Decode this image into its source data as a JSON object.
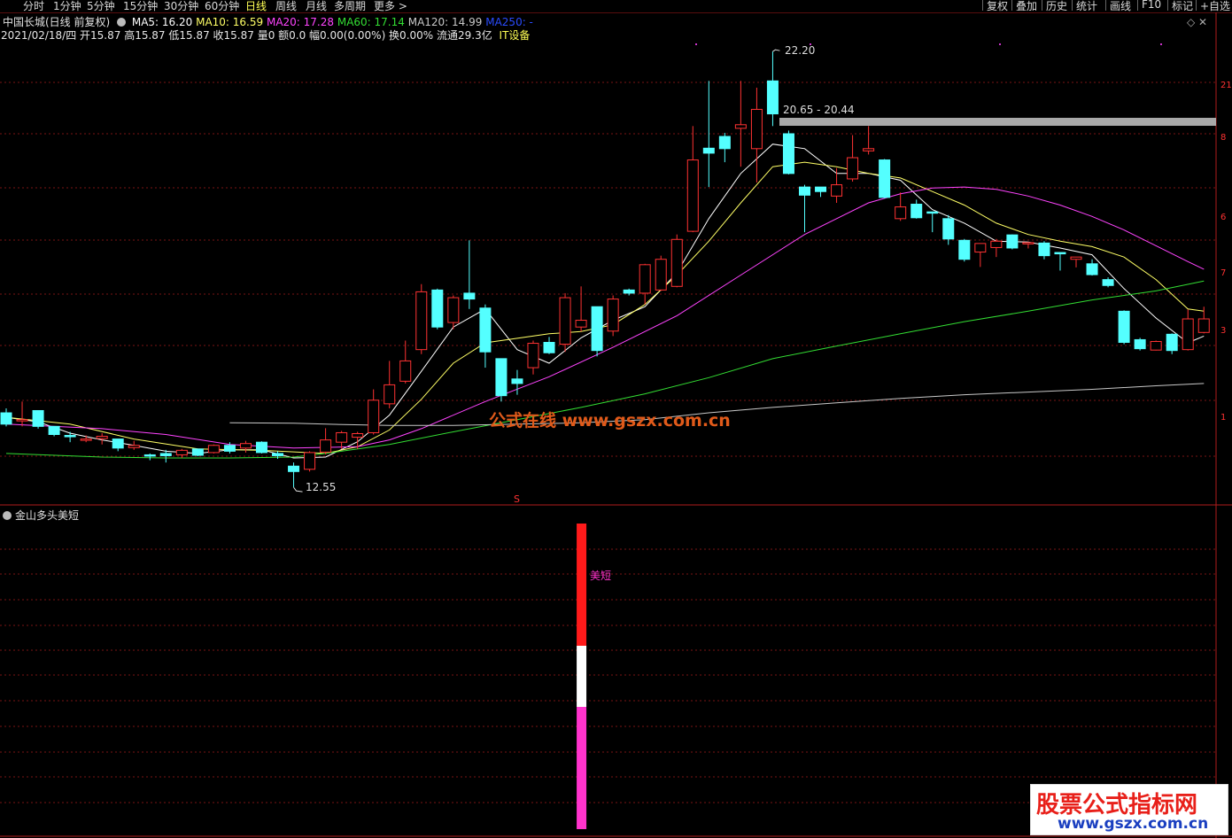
{
  "toolbar": {
    "periods": [
      "分时",
      "1分钟",
      "5分钟",
      "15分钟",
      "30分钟",
      "60分钟",
      "日线",
      "周线",
      "月线",
      "多周期",
      "更多 >"
    ],
    "active_period": "日线",
    "right_buttons": [
      "复权",
      "叠加",
      "历史",
      "统计",
      "画线",
      "F10",
      "标记",
      "+自选"
    ]
  },
  "info": {
    "stock": "中国长城(日线 前复权)",
    "ma5": "MA5: 16.20",
    "ma10": "MA10: 16.59",
    "ma20": "MA20: 17.28",
    "ma60": "MA60: 17.14",
    "ma120": "MA120: 14.99",
    "ma250": "MA250: -",
    "bar_line": "2021/02/18/四 开15.87 高15.87 低15.87 收15.87 量0 额0.0 幅0.00(0.00%) 换0.00% 流通29.3亿",
    "sector": "IT设备"
  },
  "colors": {
    "up": "#ff3232",
    "down": "#54ffff",
    "ma5": "#ffffff",
    "ma10": "#ffff66",
    "ma20": "#ff44ff",
    "ma60": "#33dd33",
    "ma120": "#c8c8c8",
    "ma250": "#2a4cff",
    "grid": "#7a1414"
  },
  "annotations": {
    "high": "22.20",
    "low": "12.55",
    "zone": "20.65 - 20.44",
    "signal_marker": "S"
  },
  "right_axis_fragments": [
    "21",
    "8",
    "6",
    "7",
    "3",
    "1"
  ],
  "sub_panel": {
    "title": "金山多头美短",
    "signal_label": "美短"
  },
  "watermarks": {
    "center": "公式在线  www.gszx.com.cn",
    "corner_title": "股票公式指标网",
    "corner_url": "www.gszx.com.cn"
  },
  "chart_data": {
    "type": "candlestick",
    "price_axis_range": [
      12.2,
      22.4
    ],
    "candles": [
      {
        "o": 14.2,
        "h": 14.3,
        "l": 13.9,
        "c": 13.95
      },
      {
        "o": 14.05,
        "h": 14.45,
        "l": 13.9,
        "c": 14.05
      },
      {
        "o": 14.25,
        "h": 14.25,
        "l": 13.85,
        "c": 13.9
      },
      {
        "o": 13.9,
        "h": 13.9,
        "l": 13.68,
        "c": 13.72
      },
      {
        "o": 13.7,
        "h": 13.78,
        "l": 13.55,
        "c": 13.68
      },
      {
        "o": 13.6,
        "h": 13.7,
        "l": 13.55,
        "c": 13.62
      },
      {
        "o": 13.63,
        "h": 13.75,
        "l": 13.5,
        "c": 13.68
      },
      {
        "o": 13.62,
        "h": 13.62,
        "l": 13.35,
        "c": 13.42
      },
      {
        "o": 13.43,
        "h": 13.58,
        "l": 13.38,
        "c": 13.48
      },
      {
        "o": 13.27,
        "h": 13.3,
        "l": 13.15,
        "c": 13.26
      },
      {
        "o": 13.3,
        "h": 13.38,
        "l": 13.1,
        "c": 13.25
      },
      {
        "o": 13.27,
        "h": 13.4,
        "l": 13.2,
        "c": 13.37
      },
      {
        "o": 13.4,
        "h": 13.4,
        "l": 13.24,
        "c": 13.26
      },
      {
        "o": 13.32,
        "h": 13.5,
        "l": 13.3,
        "c": 13.48
      },
      {
        "o": 13.48,
        "h": 13.55,
        "l": 13.3,
        "c": 13.35
      },
      {
        "o": 13.42,
        "h": 13.58,
        "l": 13.32,
        "c": 13.52
      },
      {
        "o": 13.55,
        "h": 13.57,
        "l": 13.3,
        "c": 13.32
      },
      {
        "o": 13.3,
        "h": 13.35,
        "l": 13.18,
        "c": 13.25
      },
      {
        "o": 13.02,
        "h": 13.1,
        "l": 12.55,
        "c": 12.9
      },
      {
        "o": 12.95,
        "h": 13.35,
        "l": 12.9,
        "c": 13.32
      },
      {
        "o": 13.33,
        "h": 13.86,
        "l": 13.28,
        "c": 13.6
      },
      {
        "o": 13.55,
        "h": 13.8,
        "l": 13.4,
        "c": 13.76
      },
      {
        "o": 13.66,
        "h": 13.78,
        "l": 13.4,
        "c": 13.74
      },
      {
        "o": 13.76,
        "h": 14.72,
        "l": 13.72,
        "c": 14.48
      },
      {
        "o": 14.4,
        "h": 15.35,
        "l": 14.3,
        "c": 14.82
      },
      {
        "o": 14.9,
        "h": 15.8,
        "l": 14.85,
        "c": 15.35
      },
      {
        "o": 15.6,
        "h": 17.05,
        "l": 15.5,
        "c": 16.88
      },
      {
        "o": 16.92,
        "h": 16.95,
        "l": 16.05,
        "c": 16.1
      },
      {
        "o": 16.2,
        "h": 16.8,
        "l": 16.05,
        "c": 16.75
      },
      {
        "o": 16.85,
        "h": 18.02,
        "l": 16.5,
        "c": 16.72
      },
      {
        "o": 16.52,
        "h": 16.6,
        "l": 15.2,
        "c": 15.55
      },
      {
        "o": 15.4,
        "h": 15.4,
        "l": 14.45,
        "c": 14.58
      },
      {
        "o": 14.95,
        "h": 15.15,
        "l": 14.6,
        "c": 14.85
      },
      {
        "o": 15.2,
        "h": 15.8,
        "l": 15.05,
        "c": 15.74
      },
      {
        "o": 15.76,
        "h": 15.88,
        "l": 15.5,
        "c": 15.53
      },
      {
        "o": 15.72,
        "h": 16.85,
        "l": 15.55,
        "c": 16.75
      },
      {
        "o": 16.1,
        "h": 17.0,
        "l": 16.0,
        "c": 16.25
      },
      {
        "o": 16.55,
        "h": 16.55,
        "l": 15.45,
        "c": 15.58
      },
      {
        "o": 16.01,
        "h": 16.8,
        "l": 15.9,
        "c": 16.72
      },
      {
        "o": 16.92,
        "h": 16.95,
        "l": 16.8,
        "c": 16.85
      },
      {
        "o": 16.85,
        "h": 17.5,
        "l": 16.6,
        "c": 17.48
      },
      {
        "o": 16.92,
        "h": 17.68,
        "l": 16.9,
        "c": 17.6
      },
      {
        "o": 17.0,
        "h": 18.15,
        "l": 16.98,
        "c": 18.04
      },
      {
        "o": 18.22,
        "h": 20.55,
        "l": 18.2,
        "c": 19.8
      },
      {
        "o": 20.06,
        "h": 21.55,
        "l": 19.2,
        "c": 19.95
      },
      {
        "o": 20.32,
        "h": 20.4,
        "l": 19.75,
        "c": 20.05
      },
      {
        "o": 20.5,
        "h": 21.55,
        "l": 19.65,
        "c": 20.58
      },
      {
        "o": 20.05,
        "h": 21.4,
        "l": 19.3,
        "c": 20.92
      },
      {
        "o": 21.55,
        "h": 22.2,
        "l": 20.55,
        "c": 20.82
      },
      {
        "o": 20.38,
        "h": 20.45,
        "l": 19.48,
        "c": 19.5
      },
      {
        "o": 19.2,
        "h": 19.25,
        "l": 18.2,
        "c": 19.02
      },
      {
        "o": 19.2,
        "h": 19.2,
        "l": 18.98,
        "c": 19.1
      },
      {
        "o": 19.0,
        "h": 19.62,
        "l": 18.85,
        "c": 19.25
      },
      {
        "o": 19.38,
        "h": 20.35,
        "l": 19.32,
        "c": 19.85
      },
      {
        "o": 20.0,
        "h": 20.55,
        "l": 19.92,
        "c": 20.05
      },
      {
        "o": 19.8,
        "h": 19.82,
        "l": 18.95,
        "c": 18.97
      },
      {
        "o": 18.5,
        "h": 19.08,
        "l": 18.45,
        "c": 18.76
      },
      {
        "o": 18.82,
        "h": 18.92,
        "l": 18.5,
        "c": 18.52
      },
      {
        "o": 18.65,
        "h": 18.65,
        "l": 18.2,
        "c": 18.63
      },
      {
        "o": 18.5,
        "h": 18.58,
        "l": 17.92,
        "c": 18.05
      },
      {
        "o": 18.02,
        "h": 18.05,
        "l": 17.55,
        "c": 17.6
      },
      {
        "o": 17.76,
        "h": 17.9,
        "l": 17.43,
        "c": 17.95
      },
      {
        "o": 17.86,
        "h": 18.05,
        "l": 17.65,
        "c": 18.0
      },
      {
        "o": 18.14,
        "h": 18.15,
        "l": 17.82,
        "c": 17.85
      },
      {
        "o": 17.96,
        "h": 17.98,
        "l": 17.84,
        "c": 17.97
      },
      {
        "o": 17.96,
        "h": 18.0,
        "l": 17.6,
        "c": 17.68
      },
      {
        "o": 17.75,
        "h": 17.76,
        "l": 17.35,
        "c": 17.73
      },
      {
        "o": 17.6,
        "h": 17.65,
        "l": 17.42,
        "c": 17.65
      },
      {
        "o": 17.5,
        "h": 17.6,
        "l": 17.24,
        "c": 17.26
      },
      {
        "o": 17.15,
        "h": 17.2,
        "l": 16.98,
        "c": 17.02
      },
      {
        "o": 16.45,
        "h": 16.47,
        "l": 15.72,
        "c": 15.76
      },
      {
        "o": 15.82,
        "h": 15.86,
        "l": 15.58,
        "c": 15.62
      },
      {
        "o": 15.59,
        "h": 15.8,
        "l": 15.58,
        "c": 15.78
      },
      {
        "o": 15.94,
        "h": 15.96,
        "l": 15.5,
        "c": 15.58
      },
      {
        "o": 15.6,
        "h": 16.49,
        "l": 15.58,
        "c": 16.28
      },
      {
        "o": 15.98,
        "h": 16.55,
        "l": 15.96,
        "c": 16.28
      }
    ],
    "ma_series": [
      {
        "name": "MA5",
        "points": [
          [
            0,
            14.1
          ],
          [
            2,
            14.0
          ],
          [
            4,
            13.75
          ],
          [
            6,
            13.6
          ],
          [
            8,
            13.48
          ],
          [
            10,
            13.35
          ],
          [
            12,
            13.3
          ],
          [
            14,
            13.38
          ],
          [
            16,
            13.38
          ],
          [
            18,
            13.2
          ],
          [
            20,
            13.22
          ],
          [
            22,
            13.56
          ],
          [
            24,
            14.15
          ],
          [
            26,
            15.12
          ],
          [
            28,
            16.1
          ],
          [
            30,
            16.5
          ],
          [
            32,
            15.6
          ],
          [
            34,
            15.3
          ],
          [
            36,
            15.86
          ],
          [
            38,
            16.25
          ],
          [
            40,
            16.55
          ],
          [
            42,
            17.3
          ],
          [
            44,
            18.5
          ],
          [
            46,
            19.5
          ],
          [
            48,
            20.15
          ],
          [
            50,
            20.05
          ],
          [
            52,
            19.5
          ],
          [
            54,
            19.5
          ],
          [
            56,
            19.35
          ],
          [
            58,
            18.7
          ],
          [
            60,
            18.4
          ],
          [
            62,
            18.0
          ],
          [
            64,
            17.98
          ],
          [
            66,
            17.85
          ],
          [
            68,
            17.7
          ],
          [
            70,
            16.95
          ],
          [
            72,
            16.3
          ],
          [
            74,
            15.75
          ],
          [
            75,
            15.9
          ]
        ]
      },
      {
        "name": "MA10",
        "points": [
          [
            0,
            14.1
          ],
          [
            4,
            13.95
          ],
          [
            8,
            13.62
          ],
          [
            12,
            13.4
          ],
          [
            16,
            13.37
          ],
          [
            20,
            13.3
          ],
          [
            22,
            13.45
          ],
          [
            24,
            13.82
          ],
          [
            26,
            14.5
          ],
          [
            28,
            15.3
          ],
          [
            30,
            15.75
          ],
          [
            32,
            15.85
          ],
          [
            34,
            15.95
          ],
          [
            36,
            16.0
          ],
          [
            38,
            16.15
          ],
          [
            40,
            16.6
          ],
          [
            42,
            17.25
          ],
          [
            44,
            18.0
          ],
          [
            46,
            18.85
          ],
          [
            48,
            19.65
          ],
          [
            50,
            19.75
          ],
          [
            52,
            19.65
          ],
          [
            54,
            19.5
          ],
          [
            56,
            19.4
          ],
          [
            58,
            19.1
          ],
          [
            60,
            18.8
          ],
          [
            62,
            18.4
          ],
          [
            64,
            18.15
          ],
          [
            66,
            18.0
          ],
          [
            68,
            17.88
          ],
          [
            70,
            17.65
          ],
          [
            72,
            17.15
          ],
          [
            74,
            16.5
          ],
          [
            75,
            16.45
          ]
        ]
      },
      {
        "name": "MA20",
        "points": [
          [
            0,
            13.95
          ],
          [
            6,
            13.85
          ],
          [
            10,
            13.72
          ],
          [
            14,
            13.5
          ],
          [
            18,
            13.42
          ],
          [
            22,
            13.45
          ],
          [
            24,
            13.6
          ],
          [
            26,
            13.85
          ],
          [
            30,
            14.45
          ],
          [
            34,
            15.0
          ],
          [
            38,
            15.65
          ],
          [
            42,
            16.35
          ],
          [
            46,
            17.25
          ],
          [
            50,
            18.15
          ],
          [
            52,
            18.5
          ],
          [
            54,
            18.85
          ],
          [
            56,
            19.05
          ],
          [
            58,
            19.18
          ],
          [
            60,
            19.2
          ],
          [
            62,
            19.15
          ],
          [
            64,
            19.0
          ],
          [
            66,
            18.8
          ],
          [
            68,
            18.55
          ],
          [
            70,
            18.25
          ],
          [
            72,
            17.9
          ],
          [
            74,
            17.55
          ],
          [
            75,
            17.38
          ]
        ]
      },
      {
        "name": "MA60",
        "points": [
          [
            0,
            13.3
          ],
          [
            6,
            13.22
          ],
          [
            10,
            13.2
          ],
          [
            14,
            13.2
          ],
          [
            18,
            13.22
          ],
          [
            20,
            13.3
          ],
          [
            24,
            13.5
          ],
          [
            28,
            13.78
          ],
          [
            32,
            14.05
          ],
          [
            36,
            14.32
          ],
          [
            40,
            14.62
          ],
          [
            44,
            14.98
          ],
          [
            48,
            15.4
          ],
          [
            52,
            15.68
          ],
          [
            56,
            15.95
          ],
          [
            60,
            16.22
          ],
          [
            64,
            16.45
          ],
          [
            68,
            16.7
          ],
          [
            72,
            16.9
          ],
          [
            75,
            17.12
          ]
        ]
      },
      {
        "name": "MA120",
        "points": [
          [
            14,
            13.98
          ],
          [
            18,
            13.97
          ],
          [
            20,
            13.95
          ],
          [
            24,
            13.92
          ],
          [
            28,
            13.92
          ],
          [
            32,
            13.95
          ],
          [
            36,
            13.98
          ],
          [
            40,
            14.05
          ],
          [
            44,
            14.2
          ],
          [
            48,
            14.32
          ],
          [
            52,
            14.42
          ],
          [
            56,
            14.52
          ],
          [
            60,
            14.6
          ],
          [
            64,
            14.66
          ],
          [
            68,
            14.72
          ],
          [
            72,
            14.8
          ],
          [
            75,
            14.85
          ]
        ]
      }
    ],
    "indicator": {
      "name": "金山多头美短",
      "signal_bar": {
        "index": 36,
        "segments": [
          {
            "color": "#ff1a1a",
            "from": 0.6,
            "to": 1.0
          },
          {
            "color": "#ffffff",
            "from": 0.4,
            "to": 0.6
          },
          {
            "color": "#ff33cc",
            "from": 0.0,
            "to": 0.4
          }
        ]
      }
    }
  }
}
